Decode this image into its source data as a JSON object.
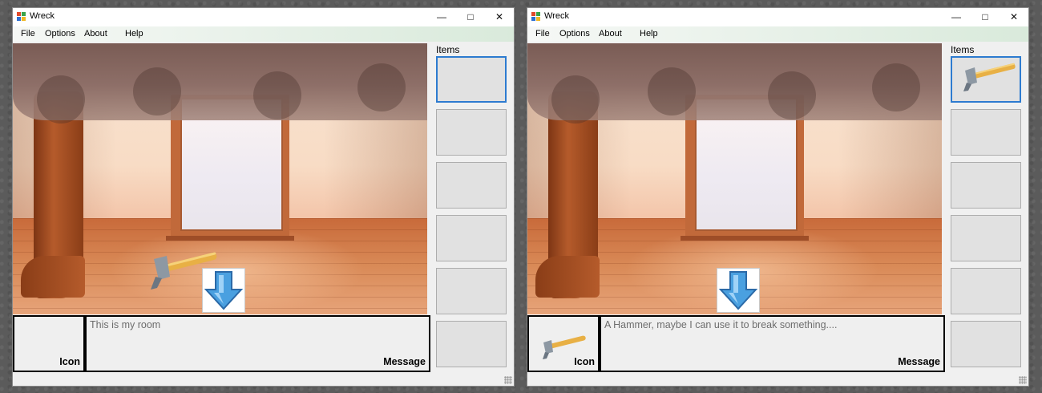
{
  "windows": [
    {
      "title": "Wreck",
      "menu": [
        "File",
        "Options",
        "About",
        "Help"
      ],
      "items_label": "Items",
      "inventory": [
        "",
        "",
        "",
        "",
        "",
        ""
      ],
      "inventory_icons": [
        "none",
        "none",
        "none",
        "none",
        "none",
        "none"
      ],
      "selected_slot": 1,
      "scene_objects": [
        "hammer-icon",
        "down-arrow-icon"
      ],
      "icon_box_label": "Icon",
      "icon_box_content": "none",
      "message_label": "Message",
      "message_text": "This is my room"
    },
    {
      "title": "Wreck",
      "menu": [
        "File",
        "Options",
        "About",
        "Help"
      ],
      "items_label": "Items",
      "inventory": [
        "",
        "",
        "",
        "",
        "",
        ""
      ],
      "inventory_icons": [
        "hammer-icon",
        "none",
        "none",
        "none",
        "none",
        "none"
      ],
      "selected_slot": 1,
      "scene_objects": [
        "down-arrow-icon"
      ],
      "icon_box_label": "Icon",
      "icon_box_content": "hammer-icon",
      "message_label": "Message",
      "message_text": "A Hammer, maybe I can use it to break something...."
    }
  ],
  "colors": {
    "selection_border": "#2d7bd0",
    "slot_fill": "#e1e1e1",
    "menubar_tint": "#d9eadb"
  }
}
